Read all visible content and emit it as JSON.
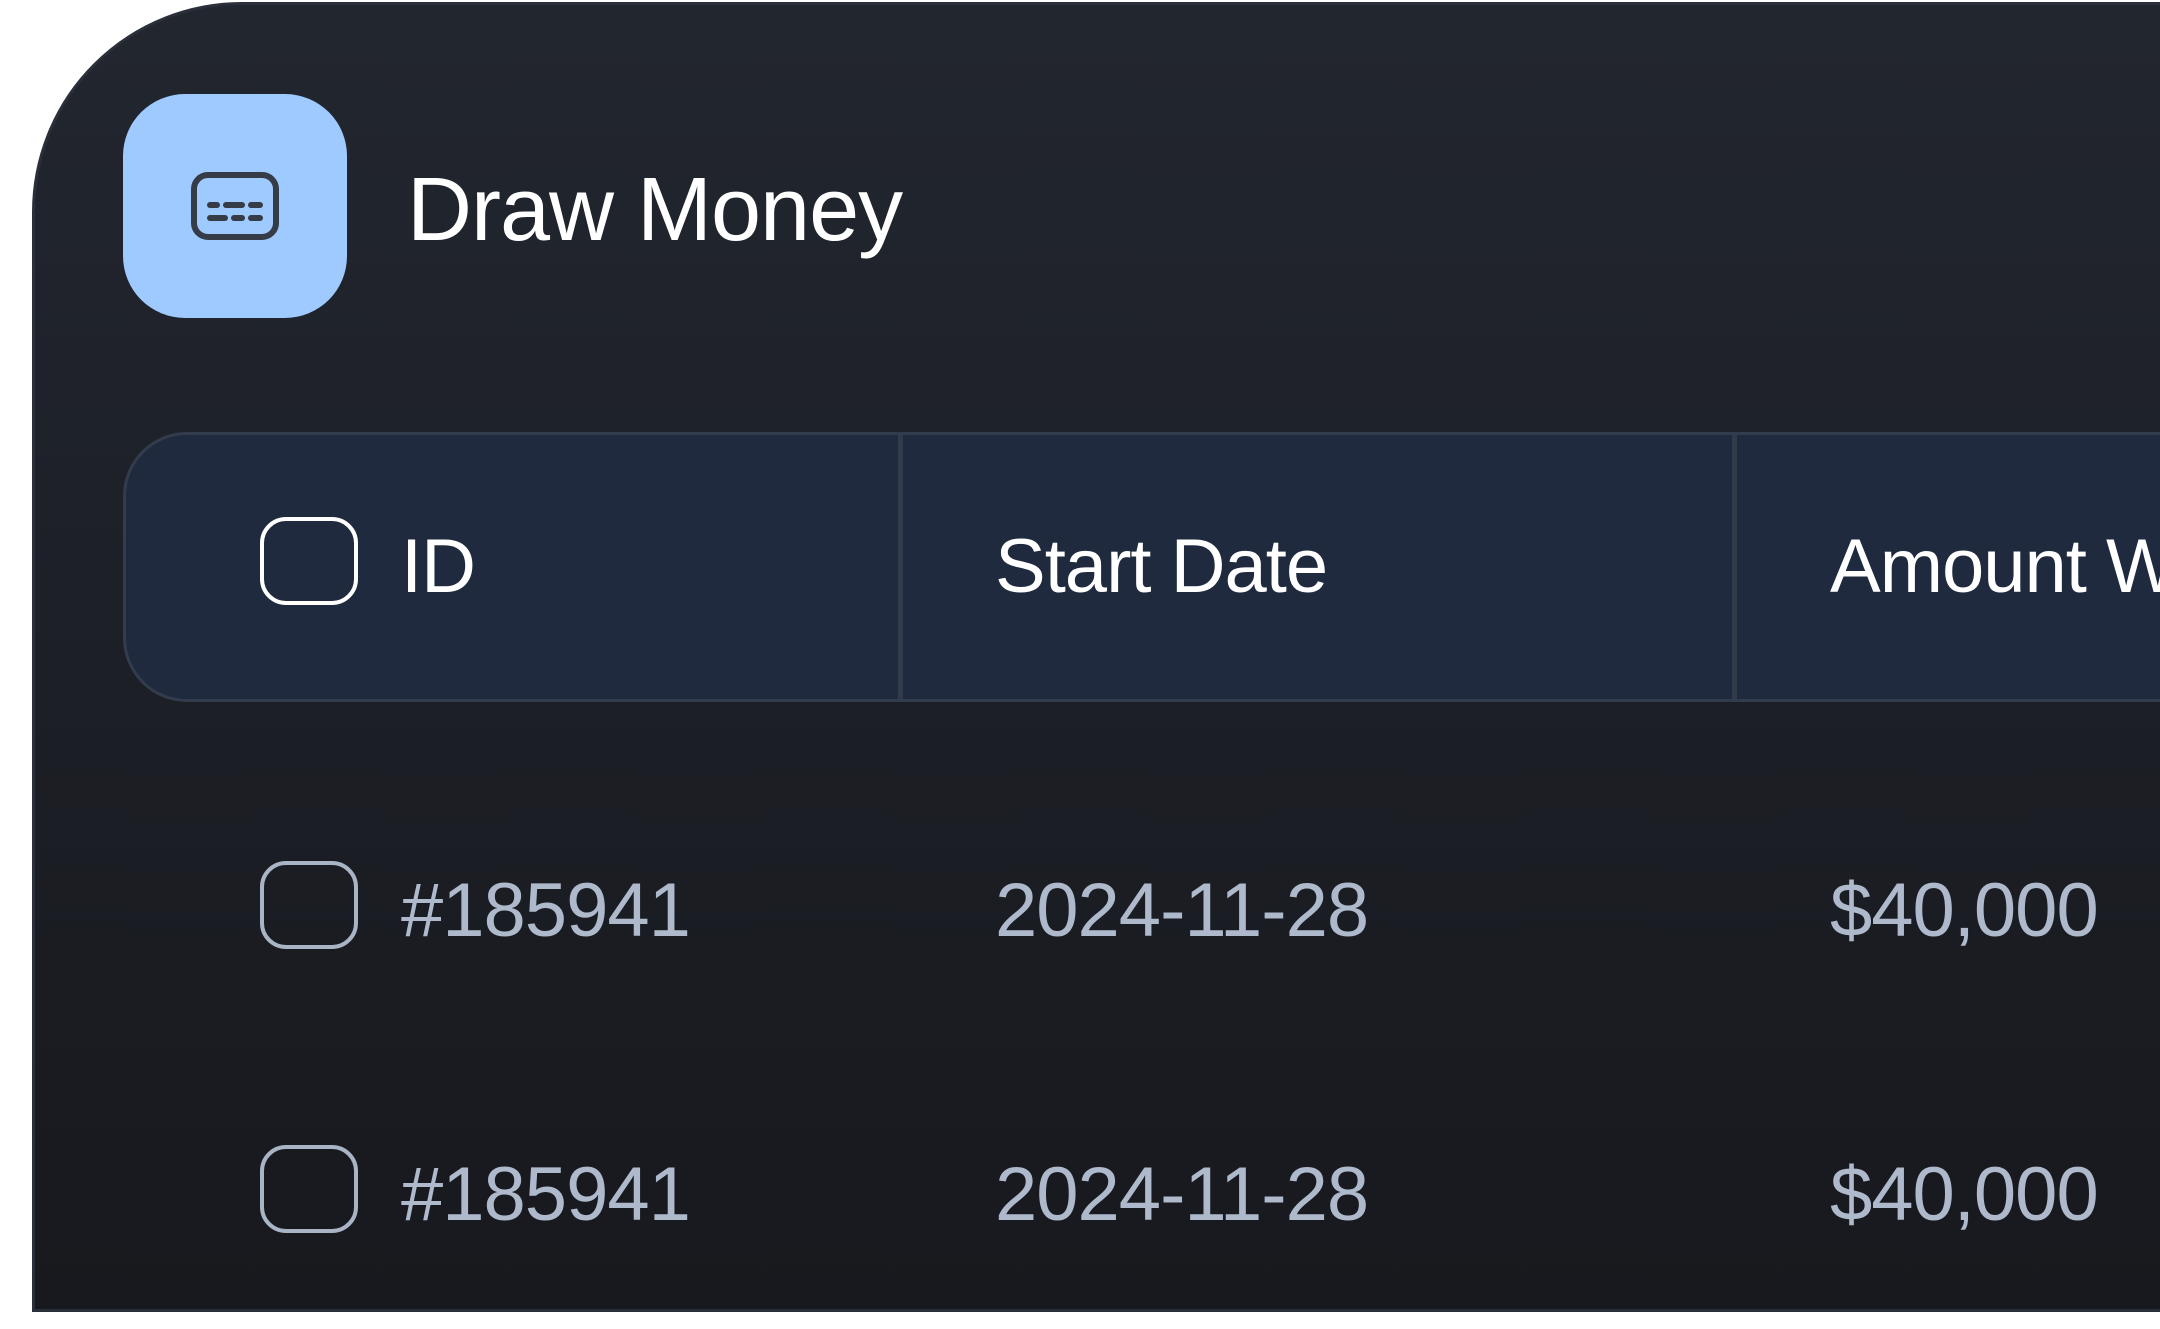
{
  "header": {
    "title": "Draw Money",
    "icon": "keyboard-icon",
    "icon_bg": "#9ecaff"
  },
  "table": {
    "columns": [
      "ID",
      "Start Date",
      "Amount W"
    ],
    "rows": [
      {
        "id": "#185941",
        "start_date": "2024-11-28",
        "amount": "$40,000"
      },
      {
        "id": "#185941",
        "start_date": "2024-11-28",
        "amount": "$40,000"
      }
    ]
  },
  "colors": {
    "card_bg": "#1d2027",
    "header_row_bg": "#1f2a3e",
    "text_primary": "#ffffff",
    "text_secondary": "#aeb9cb"
  }
}
